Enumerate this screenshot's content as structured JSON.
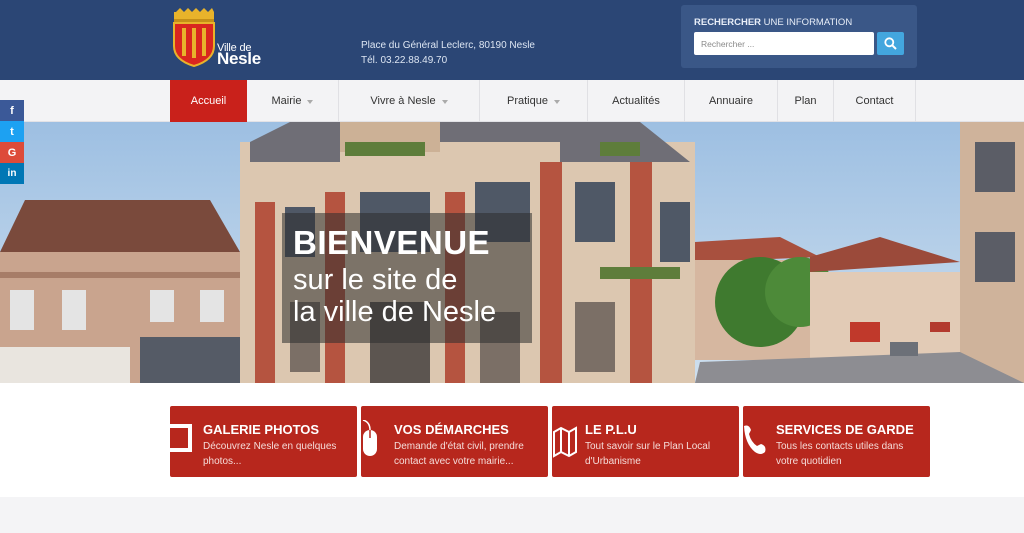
{
  "header": {
    "logo": {
      "small": "Ville de",
      "big": "Nesle"
    },
    "address": "Place du Général Leclerc, 80190 Nesle",
    "phone": "Tél. 03.22.88.49.70",
    "search": {
      "title_bold": "RECHERCHER",
      "title_rest": " UNE INFORMATION",
      "placeholder": "Rechercher ..."
    }
  },
  "nav": {
    "items": [
      {
        "label": "Accueil"
      },
      {
        "label": "Mairie"
      },
      {
        "label": "Vivre à Nesle"
      },
      {
        "label": "Pratique"
      },
      {
        "label": "Actualités"
      },
      {
        "label": "Annuaire"
      },
      {
        "label": "Plan"
      },
      {
        "label": "Contact"
      }
    ]
  },
  "social": [
    {
      "icon": "facebook-icon",
      "glyph": "f",
      "color": "#3b5998"
    },
    {
      "icon": "twitter-icon",
      "glyph": "t",
      "color": "#1da1f2"
    },
    {
      "icon": "google-plus-icon",
      "glyph": "G",
      "color": "#dd4b39"
    },
    {
      "icon": "linkedin-icon",
      "glyph": "in",
      "color": "#0077b5"
    }
  ],
  "hero": {
    "title": "BIENVENUE",
    "line1": "sur le site de",
    "line2": "la ville de Nesle"
  },
  "tiles": [
    {
      "title": "GALERIE PHOTOS",
      "desc": "Découvrez Nesle en quelques photos...",
      "icon": "photo-frame-icon"
    },
    {
      "title": "VOS DÉMARCHES",
      "desc": "Demande d'état civil, prendre contact avec votre mairie...",
      "icon": "mouse-icon"
    },
    {
      "title": "LE P.L.U",
      "desc": "Tout savoir sur le Plan Local d'Urbanisme",
      "icon": "map-icon"
    },
    {
      "title": "SERVICES DE GARDE",
      "desc": "Tous les contacts utiles dans votre quotidien",
      "icon": "phone-icon"
    }
  ],
  "colors": {
    "header": "#2b4675",
    "accent": "#c9211b",
    "tile": "#b7271d",
    "search_button": "#43a6de"
  }
}
